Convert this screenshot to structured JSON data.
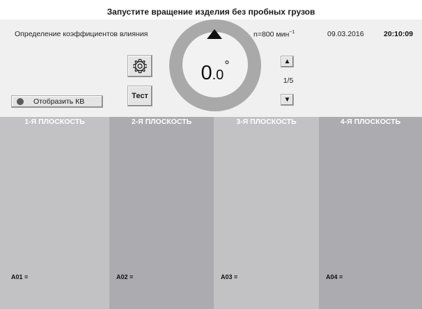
{
  "title": "Запустите вращение изделия без пробных грузов",
  "header": {
    "mode": "Определение коэффициентов влияния",
    "rpm_text": "n=800 мин",
    "rpm_unit_exp": "−1",
    "date": "09.03.2016",
    "time": "20:10:09"
  },
  "dial": {
    "angle_int": "0",
    "angle_frac": ".0",
    "angle_unit": "°"
  },
  "controls": {
    "kv_label": "Отобразить КВ",
    "test_label": "Тест",
    "up_arrow": "▲",
    "down_arrow": "▼",
    "page": "1/5"
  },
  "icons": {
    "settings": "gear-icon",
    "indicator": "status-dot-icon",
    "pointer": "pointer-triangle-icon"
  },
  "colors": {
    "column_light": "#c2c2c5",
    "column_dark": "#acacb0",
    "dial_ring": "#a9a9a9"
  },
  "planes": [
    {
      "title": "1-Я ПЛОСКОСТЬ",
      "value": "A01 ="
    },
    {
      "title": "2-Я ПЛОСКОСТЬ",
      "value": "A02 ="
    },
    {
      "title": "3-Я ПЛОСКОСТЬ",
      "value": "A03 ="
    },
    {
      "title": "4-Я ПЛОСКОСТЬ",
      "value": "A04 ="
    }
  ]
}
